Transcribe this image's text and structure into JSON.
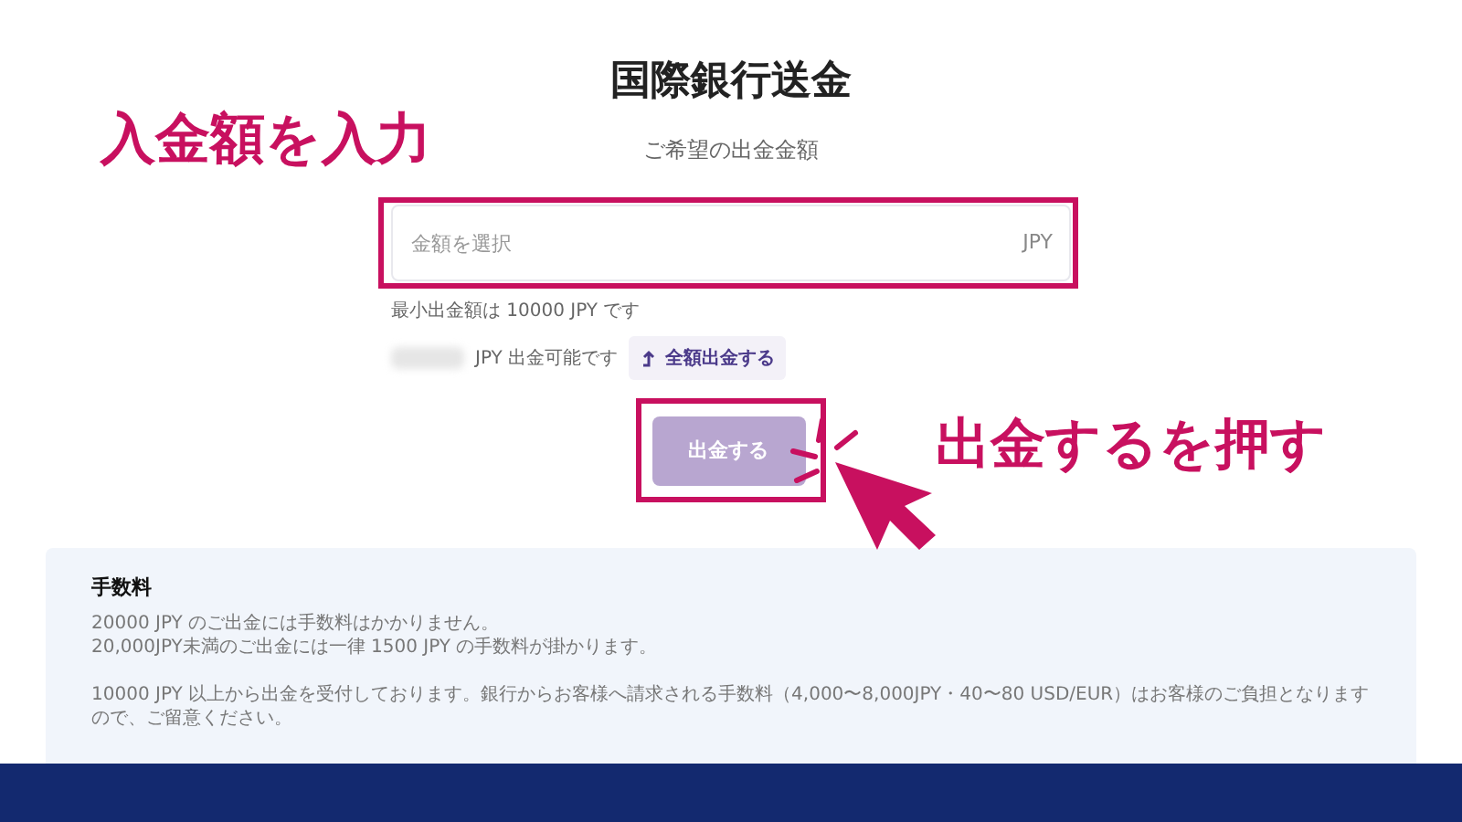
{
  "title": "国際銀行送金",
  "amount_label": "ご希望の出金金額",
  "amount_field": {
    "placeholder": "金額を選択",
    "currency": "JPY"
  },
  "minimum_note": "最小出金額は 10000 JPY です",
  "available_note": "JPY 出金可能です",
  "withdraw_all_button": "全額出金する",
  "withdraw_button": {
    "label": "出金する",
    "disabled": true
  },
  "fees": {
    "heading": "手数料",
    "lines": [
      "20000 JPY のご出金には手数料はかかりません。",
      "20,000JPY未満のご出金には一律 1500 JPY の手数料が掛かります。"
    ],
    "note": "10000 JPY 以上から出金を受付しております。銀行からお客様へ請求される手数料（4,000〜8,000JPY・40〜80 USD/EUR）はお客様のご負担となりますので、ご留意ください。"
  },
  "annotations": [
    {
      "text": "入金額を入力"
    },
    {
      "text": "出金するを押す"
    }
  ]
}
